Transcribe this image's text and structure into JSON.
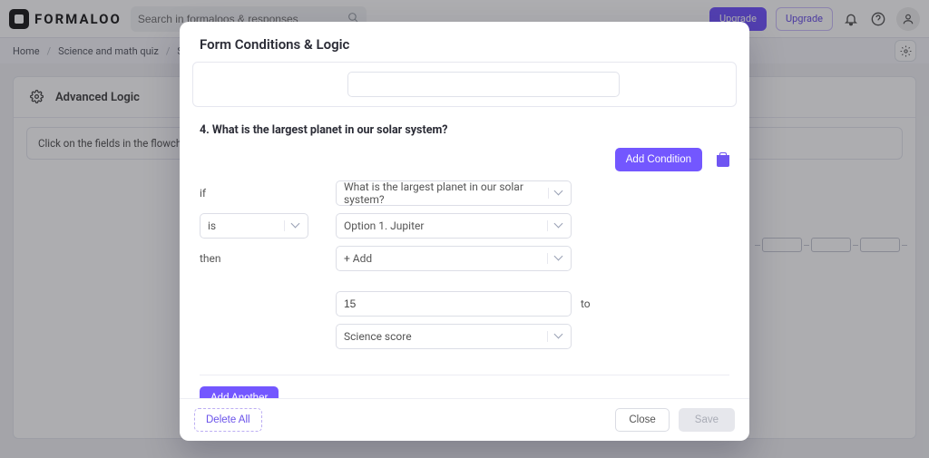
{
  "header": {
    "brand": "FORMALOO",
    "search_placeholder": "Search in formaloos & responses",
    "upgrade_primary": "Upgrade",
    "upgrade_secondary": "Upgrade"
  },
  "breadcrumb": {
    "items": [
      "Home",
      "Science and math quiz",
      "Science a"
    ]
  },
  "panel": {
    "title": "Advanced Logic",
    "hint": "Click on the fields in the flowchart to"
  },
  "modal": {
    "title": "Form Conditions & Logic",
    "question": "4. What is the largest planet in our solar system?",
    "add_condition": "Add Condition",
    "labels": {
      "if": "if",
      "then": "then",
      "to": "to"
    },
    "fields": {
      "field_select": "What is the largest planet in our solar system?",
      "operator": "is",
      "option": "Option 1. Jupiter",
      "action": "+ Add",
      "value": "15",
      "target": "Science score"
    },
    "add_another": "Add Another",
    "footer": {
      "delete_all": "Delete All",
      "close": "Close",
      "save": "Save"
    }
  }
}
